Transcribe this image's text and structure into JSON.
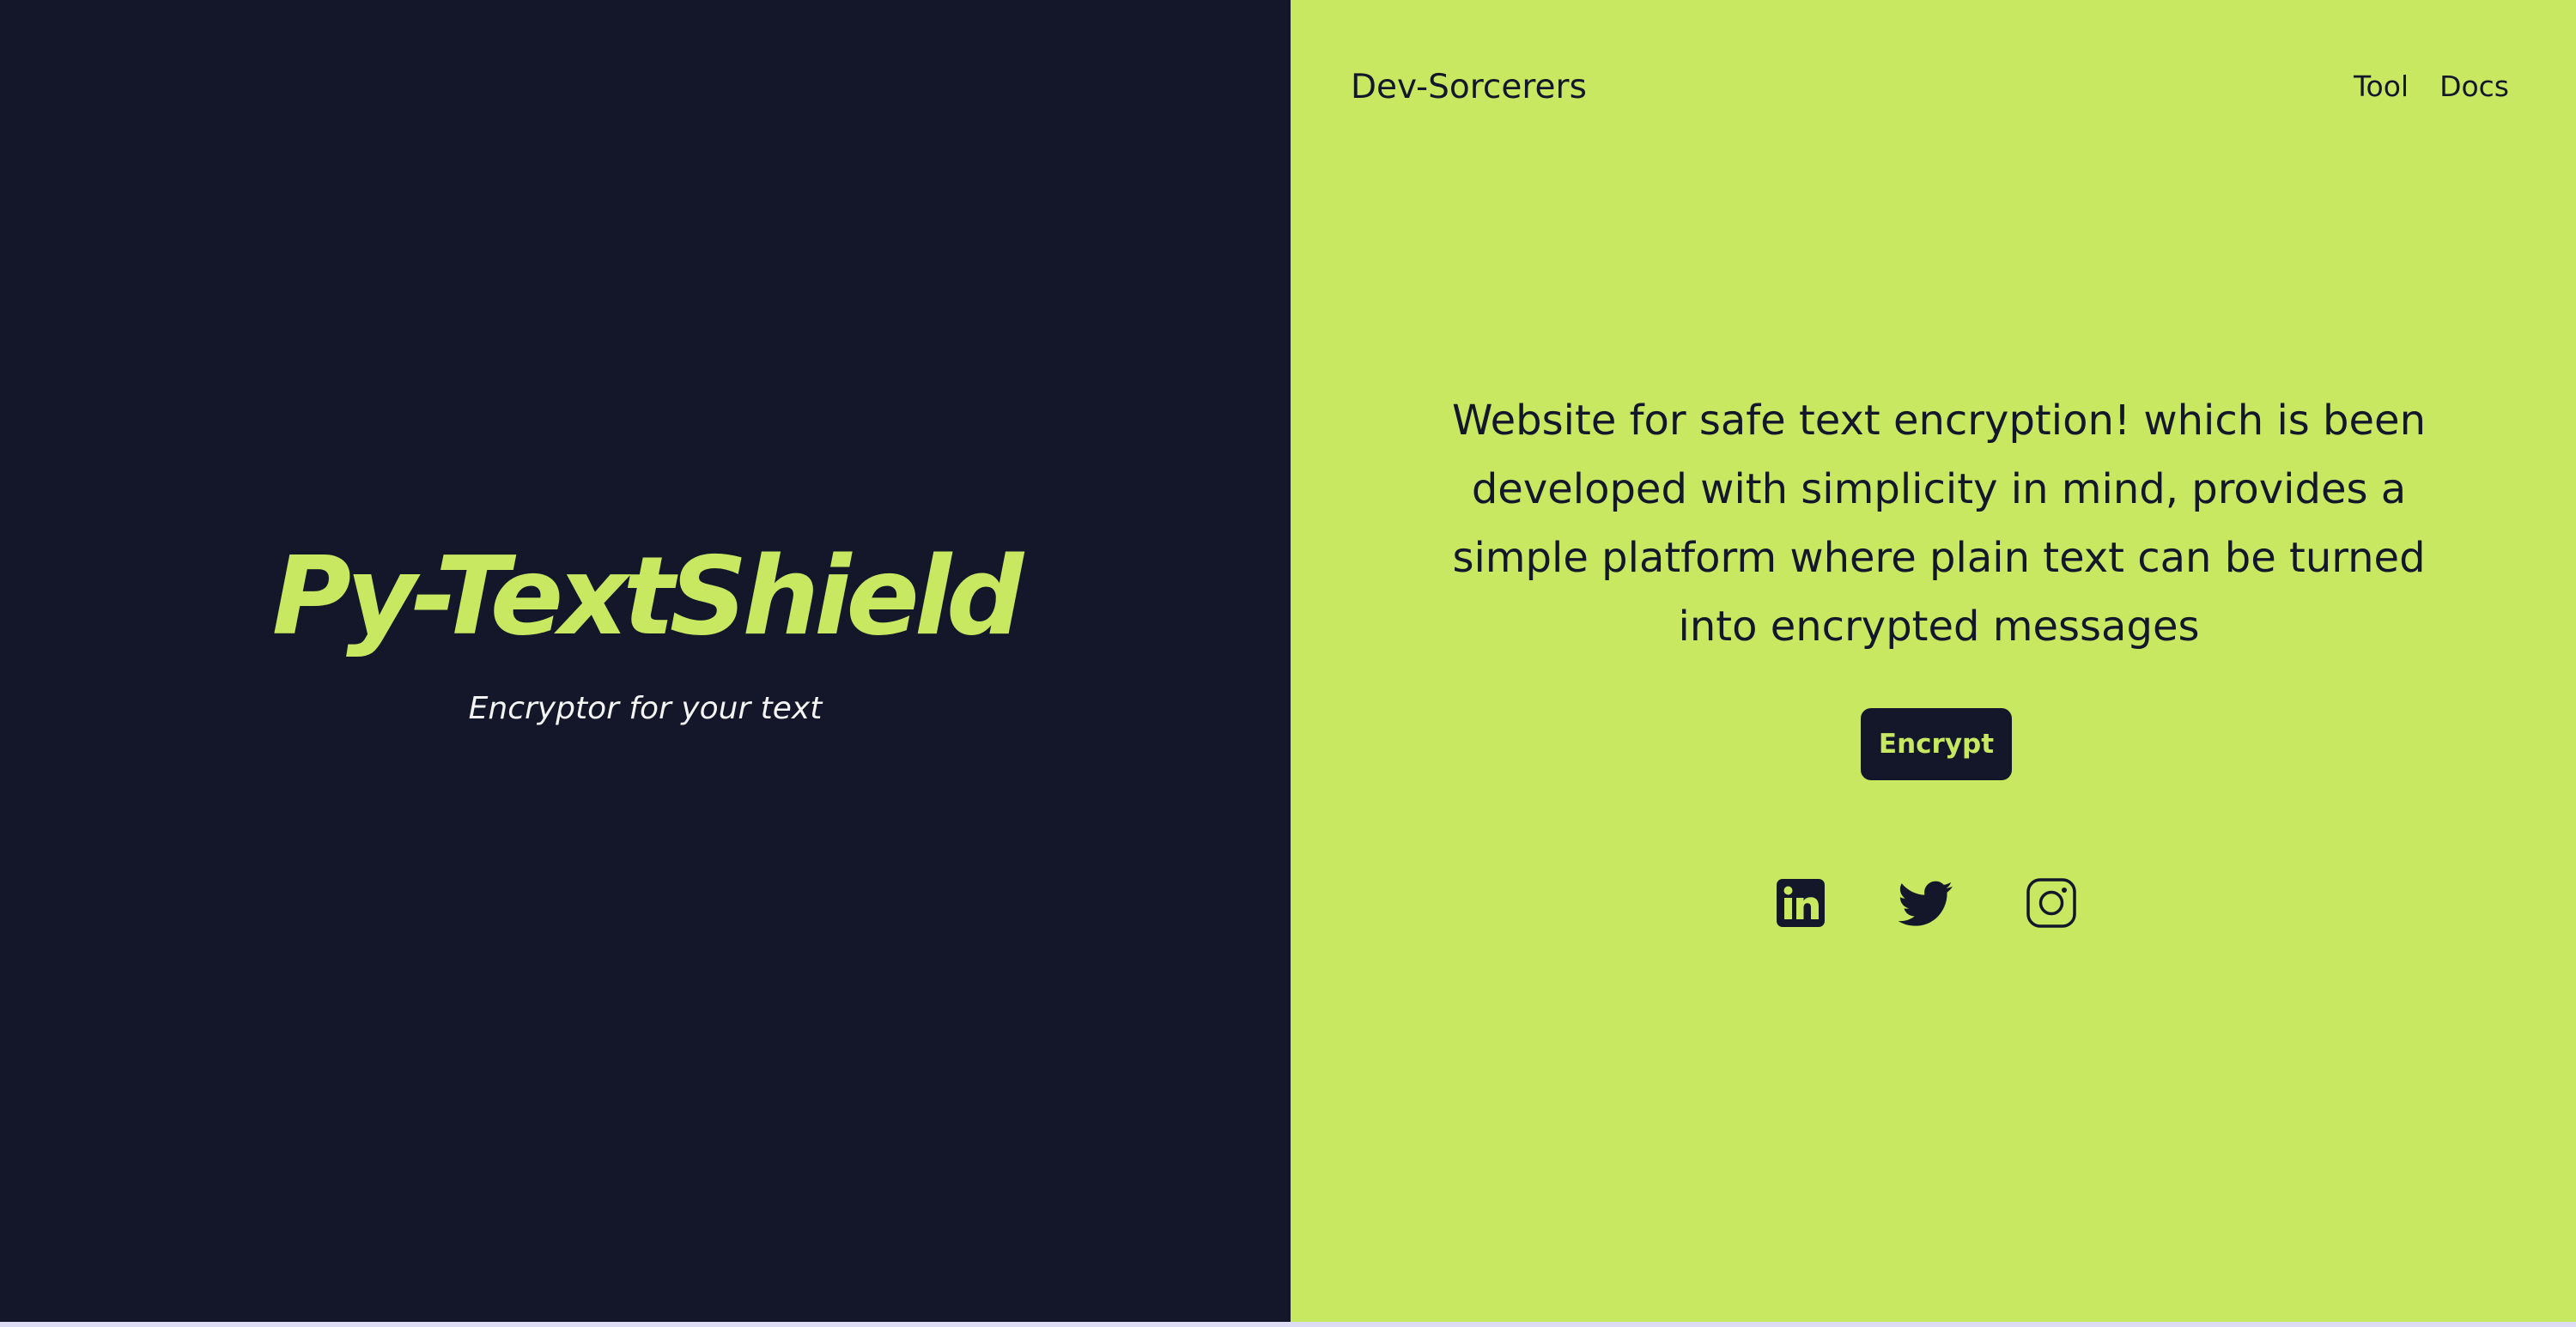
{
  "hero": {
    "title": "Py-TextShield",
    "subtitle": "Encryptor for your text"
  },
  "header": {
    "brand": "Dev-Sorcerers",
    "nav": [
      {
        "label": "Tool"
      },
      {
        "label": "Docs"
      }
    ]
  },
  "main": {
    "description": "Website for safe text encryption! which is been developed with simplicity in mind, provides a simple platform where plain text can be turned into encrypted messages",
    "encrypt_label": "Encrypt"
  },
  "socials": [
    {
      "icon": "linkedin-icon"
    },
    {
      "icon": "twitter-icon"
    },
    {
      "icon": "instagram-icon"
    }
  ],
  "colors": {
    "dark": "#131729",
    "accent": "#c9e862",
    "light_text": "#f4f4f4"
  }
}
